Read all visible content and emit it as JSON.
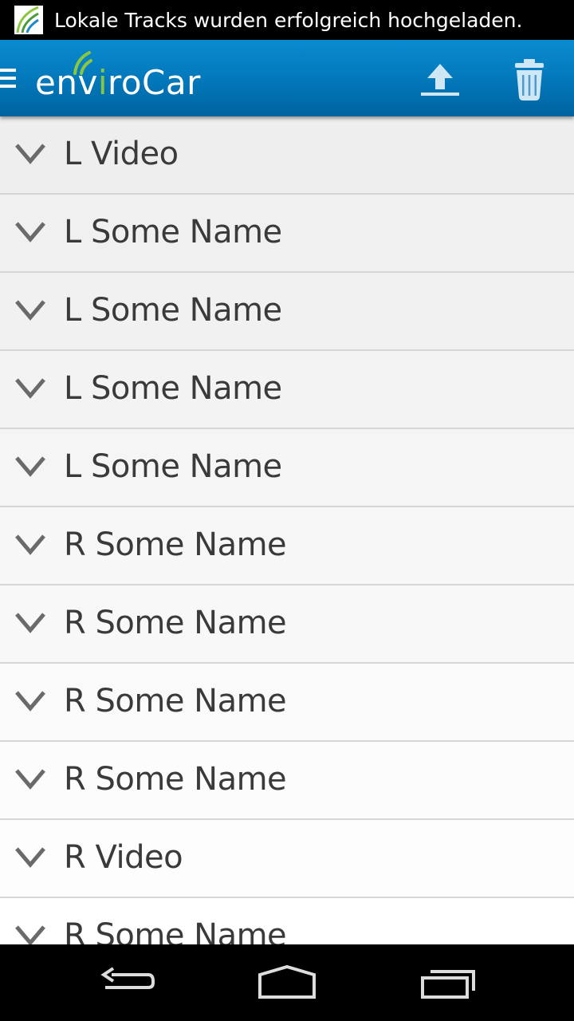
{
  "status_bar": {
    "notification_text": "Lokale Tracks wurden erfolgreich hochgeladen.",
    "notification_icon": "envirocar-icon"
  },
  "action_bar": {
    "app_name_prefix": "env",
    "app_name_i": "i",
    "app_name_suffix": "roCar",
    "upload_icon": "upload-icon",
    "delete_icon": "trash-icon",
    "menu_icon": "drawer-menu-icon"
  },
  "tracks": [
    {
      "label": "L Video"
    },
    {
      "label": "L Some Name"
    },
    {
      "label": "L Some Name"
    },
    {
      "label": "L Some Name"
    },
    {
      "label": "L Some Name"
    },
    {
      "label": "R Some Name"
    },
    {
      "label": "R Some Name"
    },
    {
      "label": "R Some Name"
    },
    {
      "label": "R Some Name"
    },
    {
      "label": "R Video"
    },
    {
      "label": "R Some Name"
    }
  ],
  "nav_bar": {
    "back_icon": "back-icon",
    "home_icon": "home-icon",
    "recents_icon": "recents-icon"
  },
  "colors": {
    "action_bar": "#0277b9",
    "logo_accent": "#8cc63f",
    "list_text": "#3a3a3a",
    "divider": "#d6d6d6"
  }
}
